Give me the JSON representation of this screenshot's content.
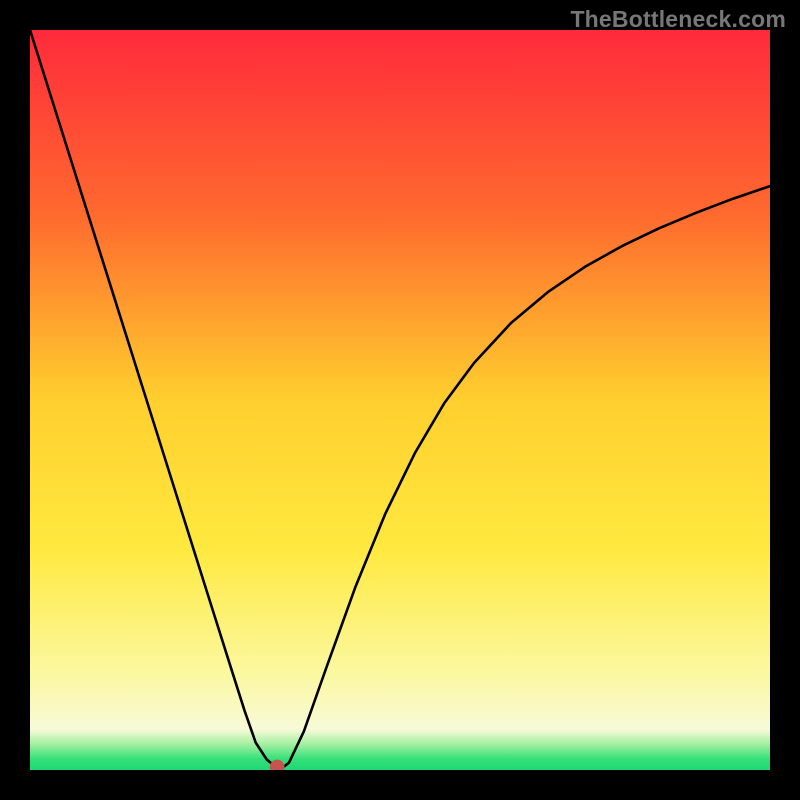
{
  "watermark": "TheBottleneck.com",
  "chart_data": {
    "type": "line",
    "title": "",
    "xlabel": "",
    "ylabel": "",
    "xlim": [
      0,
      100
    ],
    "ylim": [
      0,
      100
    ],
    "grid": false,
    "legend": false,
    "gradient_stops": [
      {
        "offset": 0.0,
        "color": "#ff2a3c"
      },
      {
        "offset": 0.25,
        "color": "#ff6a2e"
      },
      {
        "offset": 0.5,
        "color": "#ffcf2e"
      },
      {
        "offset": 0.7,
        "color": "#ffe93f"
      },
      {
        "offset": 0.87,
        "color": "#fbf8a0"
      },
      {
        "offset": 0.945,
        "color": "#f8fad8"
      },
      {
        "offset": 0.965,
        "color": "#a3f0a0"
      },
      {
        "offset": 0.985,
        "color": "#35e07a"
      },
      {
        "offset": 1.0,
        "color": "#1fd873"
      }
    ],
    "series": [
      {
        "name": "bottleneck-curve",
        "x": [
          0,
          4,
          8,
          12,
          16,
          20,
          24,
          27,
          29,
          30.5,
          32,
          33,
          34,
          35,
          37,
          40,
          44,
          48,
          52,
          56,
          60,
          65,
          70,
          75,
          80,
          85,
          90,
          95,
          100
        ],
        "y": [
          100,
          87.3,
          74.6,
          61.9,
          49.2,
          36.5,
          23.8,
          14.3,
          8.0,
          3.7,
          1.4,
          0.6,
          0.2,
          1.0,
          5.2,
          13.7,
          24.8,
          34.6,
          42.8,
          49.6,
          55.0,
          60.4,
          64.6,
          68.0,
          70.8,
          73.2,
          75.3,
          77.2,
          78.9
        ]
      }
    ],
    "marker": {
      "x": 33.4,
      "y": 0.4,
      "r": 1.0,
      "color": "#c5564f"
    }
  }
}
